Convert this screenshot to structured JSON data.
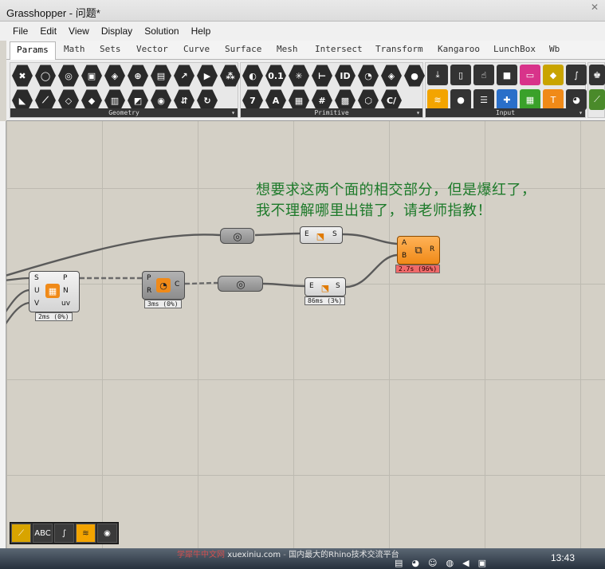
{
  "window": {
    "title": "Grasshopper - 问题*"
  },
  "menu": [
    "File",
    "Edit",
    "View",
    "Display",
    "Solution",
    "Help"
  ],
  "tabs": [
    "Params",
    "Math",
    "Sets",
    "Vector",
    "Curve",
    "Surface",
    "Mesh",
    "Intersect",
    "Transform",
    "Kangaroo",
    "LunchBox",
    "Wb"
  ],
  "active_tab": "Params",
  "panels": {
    "geometry": {
      "label": "Geometry"
    },
    "primitive": {
      "label": "Primitive",
      "buttons": [
        "0.1",
        "ID",
        "7",
        "A",
        "C/"
      ]
    },
    "input": {
      "label": "Input"
    }
  },
  "annotation": {
    "line1": "想要求这两个面的相交部分，但是爆红了，",
    "line2": "我不理解哪里出错了，请老师指教！"
  },
  "components": {
    "surface_divide": {
      "inputs": [
        "S",
        "U",
        "V"
      ],
      "outputs": [
        "P",
        "N",
        "uv"
      ],
      "timing": "2ms (0%)"
    },
    "polygon": {
      "inputs": [
        "P",
        "R"
      ],
      "outputs": [
        "C"
      ],
      "timing": "3ms (0%)"
    },
    "extrude_top": {
      "inputs": [
        "E"
      ],
      "outputs": [
        "S"
      ]
    },
    "extrude_bottom": {
      "inputs": [
        "E"
      ],
      "outputs": [
        "S"
      ],
      "timing": "86ms (3%)"
    },
    "brep_intersect": {
      "inputs": [
        "A",
        "B"
      ],
      "outputs": [
        "R"
      ],
      "timing": "2.7s (96%)",
      "state_color": "#f08a18"
    }
  },
  "watermark": {
    "site": "学犀牛中文网",
    "url": "xuexiniu.com",
    "slogan": "国内最大的Rhino技术交流平台"
  },
  "taskbar": {
    "clock": "13:43"
  }
}
